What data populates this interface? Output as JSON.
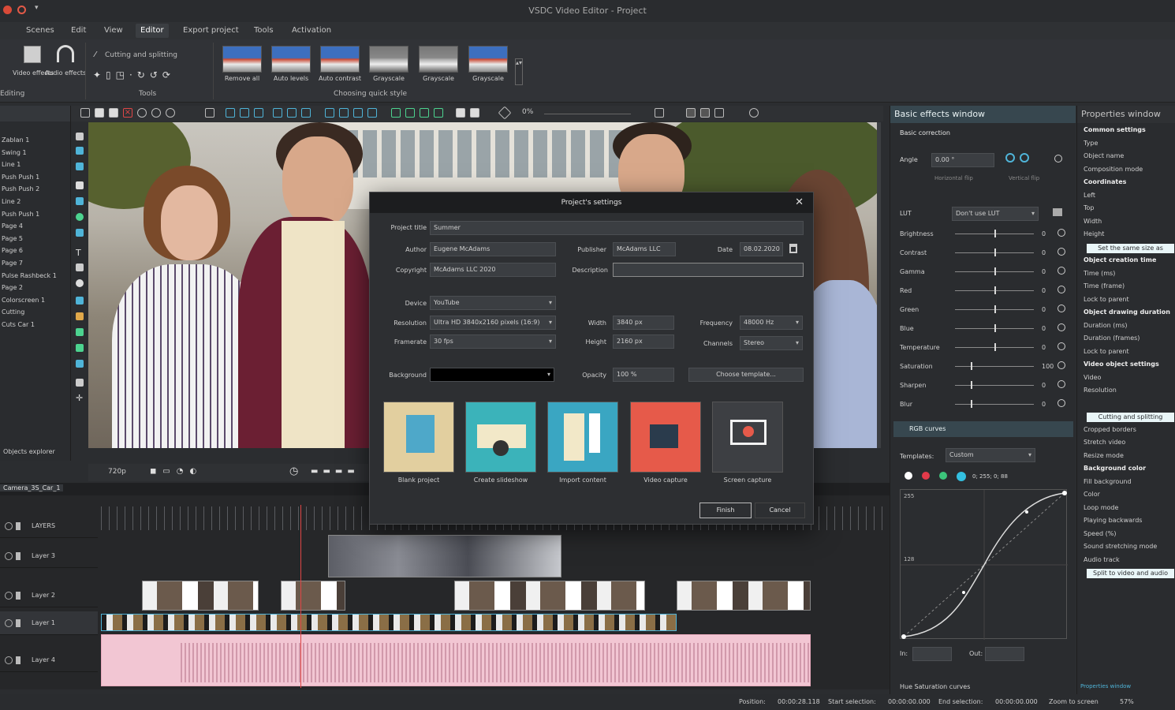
{
  "app": {
    "title": "VSDC Video Editor - Project"
  },
  "menu": [
    "Scenes",
    "Edit",
    "View",
    "Editor",
    "Export project",
    "Tools",
    "Activation"
  ],
  "ribbon": {
    "tools": [
      "Video effects",
      "Audio effects"
    ],
    "cutting_label": "Cutting and splitting",
    "tools_group": "Tools",
    "left_group": "Editing",
    "quick_style_group": "Choosing quick style",
    "quick_styles": [
      "Remove all",
      "Auto levels",
      "Auto contrast",
      "Grayscale",
      "Grayscale",
      "Grayscale"
    ]
  },
  "objects_panel": {
    "items": [
      "Zablan 1",
      "Swing 1",
      "Line 1",
      "Push Push 1",
      "Push Push 2",
      "Line 2",
      "Push Push 1",
      "Page 4",
      "Page 5",
      "Page 6",
      "Page 7",
      "Pulse Rashbeck 1",
      "Page 2",
      "Colorscreen 1",
      "Cutting",
      "Cuts Car 1"
    ],
    "footer": "Objects explorer"
  },
  "toolbar2": {
    "zoom": "0%"
  },
  "playbar": {
    "resolution": "720p"
  },
  "timeline": {
    "tab": "Camera_3S_Car_1",
    "layers": [
      "LAYERS",
      "Layer 3",
      "Layer 2",
      "Layer 1",
      "Layer 4"
    ]
  },
  "dialog": {
    "title": "Project's settings",
    "fields": {
      "project_title_label": "Project title",
      "project_title": "Summer",
      "author_label": "Author",
      "author": "Eugene McAdams",
      "publisher_label": "Publisher",
      "publisher": "McAdams LLC",
      "date_label": "Date",
      "date": "08.02.2020",
      "copyright_label": "Copyright",
      "copyright": "McAdams LLC 2020",
      "description_label": "Description",
      "description": "",
      "device_label": "Device",
      "device": "YouTube",
      "resolution_label": "Resolution",
      "resolution": "Ultra HD 3840x2160 pixels (16:9)",
      "framerate_label": "Framerate",
      "framerate": "30 fps",
      "width_label": "Width",
      "width": "3840 px",
      "height_label": "Height",
      "height": "2160 px",
      "frequency_label": "Frequency",
      "frequency": "48000 Hz",
      "channels_label": "Channels",
      "channels": "Stereo",
      "background_label": "Background",
      "opacity_label": "Opacity",
      "opacity": "100 %",
      "choose_template": "Choose template..."
    },
    "tiles": [
      "Blank project",
      "Create slideshow",
      "Import content",
      "Video capture",
      "Screen capture"
    ],
    "finish": "Finish",
    "cancel": "Cancel"
  },
  "effects": {
    "title": "Basic effects window",
    "section": "Basic correction",
    "angle_label": "Angle",
    "angle": "0.00 °",
    "flip_h": "Horizontal flip",
    "flip_v": "Vertical flip",
    "lut_label": "LUT",
    "lut": "Don't use LUT",
    "rows": [
      {
        "label": "Brightness",
        "val": "0",
        "pos": 0.5
      },
      {
        "label": "Contrast",
        "val": "0",
        "pos": 0.5
      },
      {
        "label": "Gamma",
        "val": "0",
        "pos": 0.5
      },
      {
        "label": "Red",
        "val": "0",
        "pos": 0.5
      },
      {
        "label": "Green",
        "val": "0",
        "pos": 0.5
      },
      {
        "label": "Blue",
        "val": "0",
        "pos": 0.5
      },
      {
        "label": "Temperature",
        "val": "0",
        "pos": 0.5
      },
      {
        "label": "Saturation",
        "val": "100",
        "pos": 0.2
      },
      {
        "label": "Sharpen",
        "val": "0",
        "pos": 0.2
      },
      {
        "label": "Blur",
        "val": "0",
        "pos": 0.2
      }
    ],
    "rgb_section": "RGB curves",
    "templates_label": "Templates:",
    "templates": "Custom",
    "coords": "0; 255; 0; 88",
    "curve_top": "255",
    "curve_mid": "128",
    "in_label": "In:",
    "out_label": "Out:",
    "hue_section": "Hue Saturation curves"
  },
  "props": {
    "title": "Properties window",
    "rows": [
      {
        "t": "Common settings",
        "k": "section"
      },
      {
        "t": "Type",
        "k": ""
      },
      {
        "t": "Object name",
        "k": ""
      },
      {
        "t": "Composition mode",
        "k": ""
      },
      {
        "t": "Coordinates",
        "k": "section"
      },
      {
        "t": "Left",
        "k": ""
      },
      {
        "t": "Top",
        "k": ""
      },
      {
        "t": "Width",
        "k": ""
      },
      {
        "t": "Height",
        "k": ""
      },
      {
        "t": "Set the same size as",
        "k": "btn"
      },
      {
        "t": "Object creation time",
        "k": "section"
      },
      {
        "t": "Time (ms)",
        "k": ""
      },
      {
        "t": "Time (frame)",
        "k": ""
      },
      {
        "t": "Lock to parent",
        "k": ""
      },
      {
        "t": "Object drawing duration",
        "k": "section"
      },
      {
        "t": "Duration (ms)",
        "k": ""
      },
      {
        "t": "Duration (frames)",
        "k": ""
      },
      {
        "t": "Lock to parent",
        "k": ""
      },
      {
        "t": "Video object settings",
        "k": "section"
      },
      {
        "t": "Video",
        "k": ""
      },
      {
        "t": "Resolution",
        "k": ""
      },
      {
        "t": "",
        "k": ""
      },
      {
        "t": "Cutting and splitting",
        "k": "btn"
      },
      {
        "t": "Cropped borders",
        "k": ""
      },
      {
        "t": "Stretch video",
        "k": ""
      },
      {
        "t": "Resize mode",
        "k": ""
      },
      {
        "t": "Background color",
        "k": "section"
      },
      {
        "t": "Fill background",
        "k": ""
      },
      {
        "t": "Color",
        "k": ""
      },
      {
        "t": "Loop mode",
        "k": ""
      },
      {
        "t": "Playing backwards",
        "k": ""
      },
      {
        "t": "Speed (%)",
        "k": ""
      },
      {
        "t": "Sound stretching mode",
        "k": ""
      },
      {
        "t": "Audio track",
        "k": ""
      },
      {
        "t": "Split to video and audio",
        "k": "btn"
      }
    ],
    "footer": "Properties window"
  },
  "status": {
    "position_label": "Position:",
    "position": "00:00:28.118",
    "start_label": "Start selection:",
    "start": "00:00:00.000",
    "end_label": "End selection:",
    "end": "00:00:00.000",
    "zoom_label": "Zoom to screen",
    "zoom": "57%"
  }
}
